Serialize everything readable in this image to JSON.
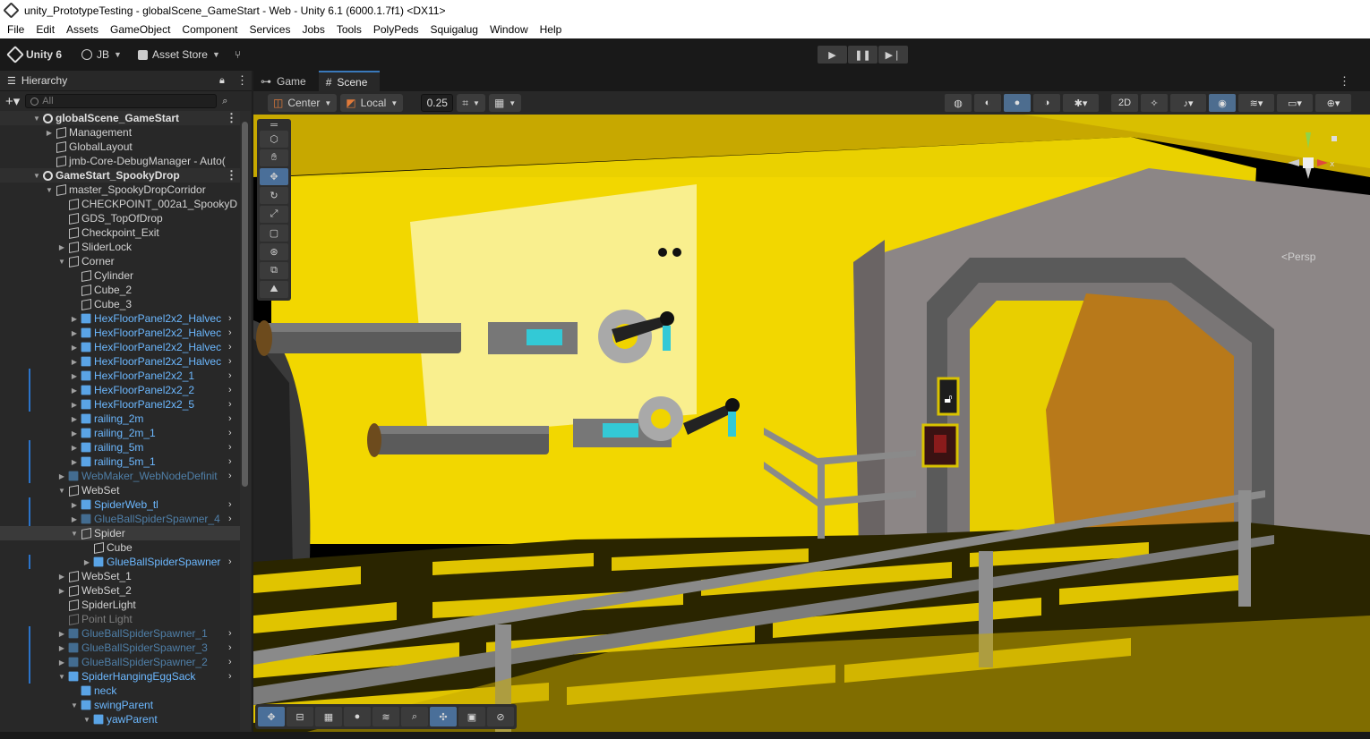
{
  "window": {
    "title": "unity_PrototypeTesting - globalScene_GameStart - Web - Unity 6.1 (6000.1.7f1) <DX11>"
  },
  "menu": [
    "File",
    "Edit",
    "Assets",
    "GameObject",
    "Component",
    "Services",
    "Jobs",
    "Tools",
    "PolyPeds",
    "Squigalug",
    "Window",
    "Help"
  ],
  "toolbar": {
    "unity_label": "Unity 6",
    "account_label": "JB",
    "asset_store_label": "Asset Store"
  },
  "hierarchy": {
    "tab_label": "Hierarchy",
    "search_placeholder": "All",
    "rows": [
      {
        "label": "globalScene_GameStart",
        "kind": "scene",
        "indent": 0
      },
      {
        "label": "Management",
        "kind": "go",
        "indent": 1,
        "arrow": "right"
      },
      {
        "label": "GlobalLayout",
        "kind": "go",
        "indent": 1
      },
      {
        "label": "jmb-Core-DebugManager - Auto(",
        "kind": "go",
        "indent": 1
      },
      {
        "label": "GameStart_SpookyDrop",
        "kind": "scene",
        "indent": 0
      },
      {
        "label": "master_SpookyDropCorridor",
        "kind": "go",
        "indent": 1,
        "arrow": "down"
      },
      {
        "label": "CHECKPOINT_002a1_SpookyD",
        "kind": "go",
        "indent": 2
      },
      {
        "label": "GDS_TopOfDrop",
        "kind": "go",
        "indent": 2
      },
      {
        "label": "Checkpoint_Exit",
        "kind": "go",
        "indent": 2
      },
      {
        "label": "SliderLock",
        "kind": "go",
        "indent": 2,
        "arrow": "right"
      },
      {
        "label": "Corner",
        "kind": "go",
        "indent": 2,
        "arrow": "down"
      },
      {
        "label": "Cylinder",
        "kind": "go",
        "indent": 3
      },
      {
        "label": "Cube_2",
        "kind": "go",
        "indent": 3
      },
      {
        "label": "Cube_3",
        "kind": "go",
        "indent": 3
      },
      {
        "label": "HexFloorPanel2x2_Halvec",
        "kind": "prefab",
        "indent": 3,
        "arrow": "right",
        "chev": true
      },
      {
        "label": "HexFloorPanel2x2_Halvec",
        "kind": "prefab",
        "indent": 3,
        "arrow": "right",
        "chev": true
      },
      {
        "label": "HexFloorPanel2x2_Halvec",
        "kind": "prefab",
        "indent": 3,
        "arrow": "right",
        "chev": true
      },
      {
        "label": "HexFloorPanel2x2_Halvec",
        "kind": "prefab",
        "indent": 3,
        "arrow": "right",
        "chev": true
      },
      {
        "label": "HexFloorPanel2x2_1",
        "kind": "prefab",
        "indent": 3,
        "arrow": "right",
        "chev": true,
        "mark": true
      },
      {
        "label": "HexFloorPanel2x2_2",
        "kind": "prefab",
        "indent": 3,
        "arrow": "right",
        "chev": true,
        "mark": true
      },
      {
        "label": "HexFloorPanel2x2_5",
        "kind": "prefab",
        "indent": 3,
        "arrow": "right",
        "chev": true,
        "mark": true
      },
      {
        "label": "railing_2m",
        "kind": "prefab",
        "indent": 3,
        "arrow": "right",
        "chev": true
      },
      {
        "label": "railing_2m_1",
        "kind": "prefab",
        "indent": 3,
        "arrow": "right",
        "chev": true
      },
      {
        "label": "railing_5m",
        "kind": "prefab",
        "indent": 3,
        "arrow": "right",
        "chev": true,
        "mark": true
      },
      {
        "label": "railing_5m_1",
        "kind": "prefab",
        "indent": 3,
        "arrow": "right",
        "chev": true,
        "mark": true
      },
      {
        "label": "WebMaker_WebNodeDefinit",
        "kind": "prefab-dim",
        "indent": 2,
        "arrow": "right",
        "chev": true,
        "mark": true
      },
      {
        "label": "WebSet",
        "kind": "go",
        "indent": 2,
        "arrow": "down"
      },
      {
        "label": "SpiderWeb_tl",
        "kind": "prefab",
        "indent": 3,
        "arrow": "right",
        "chev": true,
        "mark": true
      },
      {
        "label": "GlueBallSpiderSpawner_4",
        "kind": "prefab-dim",
        "indent": 3,
        "arrow": "right",
        "chev": true,
        "mark": true
      },
      {
        "label": "Spider",
        "kind": "go",
        "indent": 3,
        "arrow": "down",
        "selected": true
      },
      {
        "label": "Cube",
        "kind": "go",
        "indent": 4
      },
      {
        "label": "GlueBallSpiderSpawner",
        "kind": "prefab",
        "indent": 4,
        "arrow": "right",
        "chev": true,
        "mark": true
      },
      {
        "label": "WebSet_1",
        "kind": "go",
        "indent": 2,
        "arrow": "right"
      },
      {
        "label": "WebSet_2",
        "kind": "go",
        "indent": 2,
        "arrow": "right"
      },
      {
        "label": "SpiderLight",
        "kind": "go",
        "indent": 2
      },
      {
        "label": "Point Light",
        "kind": "go-dim",
        "indent": 2
      },
      {
        "label": "GlueBallSpiderSpawner_1",
        "kind": "prefab-dim",
        "indent": 2,
        "arrow": "right",
        "chev": true,
        "mark": true
      },
      {
        "label": "GlueBallSpiderSpawner_3",
        "kind": "prefab-dim",
        "indent": 2,
        "arrow": "right",
        "chev": true,
        "mark": true
      },
      {
        "label": "GlueBallSpiderSpawner_2",
        "kind": "prefab-dim",
        "indent": 2,
        "arrow": "right",
        "chev": true,
        "mark": true
      },
      {
        "label": "SpiderHangingEggSack",
        "kind": "prefab",
        "indent": 2,
        "arrow": "down",
        "chev": true,
        "mark": true
      },
      {
        "label": "neck",
        "kind": "prefab",
        "indent": 3
      },
      {
        "label": "swingParent",
        "kind": "prefab",
        "indent": 3,
        "arrow": "down"
      },
      {
        "label": "yawParent",
        "kind": "prefab",
        "indent": 4,
        "arrow": "down"
      }
    ]
  },
  "scene_view": {
    "tabs": [
      "Game",
      "Scene"
    ],
    "active_tab": "Scene",
    "pivot_mode": "Center",
    "pivot_rotation": "Local",
    "grid_snap_value": "0.25",
    "persp_label": "Persp",
    "gizmo_axis_label": "x"
  },
  "colors": {
    "accent": "#3a79bb",
    "prefab_blue": "#6cb8ff",
    "scene_yellow": "#f2d600",
    "door_orange": "#b87a14"
  }
}
